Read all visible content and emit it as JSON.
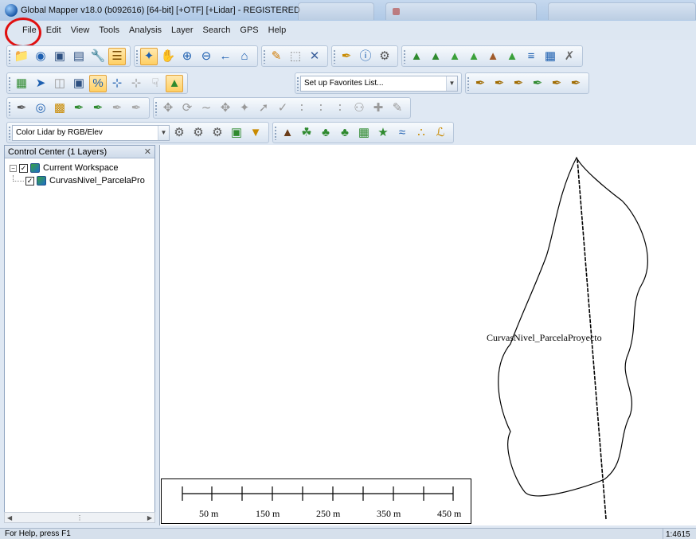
{
  "window": {
    "title": "Global Mapper v18.0 (b092616) [64-bit] [+OTF] [+Lidar] - REGISTERED"
  },
  "menu": [
    "File",
    "Edit",
    "View",
    "Tools",
    "Analysis",
    "Layer",
    "Search",
    "GPS",
    "Help"
  ],
  "toolbars": {
    "favorites_combo": "Set up Favorites List...",
    "lidar_combo": "Color Lidar by RGB/Elev"
  },
  "control_center": {
    "title": "Control Center (1 Layers)",
    "tree": [
      {
        "label": "Current Workspace",
        "checked": true,
        "expanded": true
      },
      {
        "label": "CurvasNivel_ParcelaPro",
        "checked": true
      }
    ]
  },
  "map": {
    "feature_label": "CurvasNivel_ParcelaProyecto",
    "scale_labels": [
      "50 m",
      "150 m",
      "250 m",
      "350 m",
      "450 m"
    ]
  },
  "status": {
    "help_text": "For Help, press F1",
    "scale_text": "1:4615"
  },
  "icons": {
    "row1": [
      "open-folder-icon",
      "globe-icon",
      "save-icon",
      "window-icon",
      "wrench-icon",
      "layer-stack-icon",
      "select-icon",
      "pan-icon",
      "zoom-in-icon",
      "zoom-out-icon",
      "back-arrow-icon",
      "home-icon",
      "pencil-icon",
      "rect-select-icon",
      "delete-icon",
      "measure-icon",
      "info-icon",
      "feature-info-icon",
      "terrain-1-icon",
      "terrain-2-icon",
      "terrain-3-icon",
      "terrain-4-icon",
      "terrain-5-icon",
      "terrain-6-icon",
      "terrain-7-icon",
      "terrain-8-icon",
      "terrain-9-icon"
    ],
    "colors": {
      "accent": "#ffcf63",
      "highlight": "#e01010"
    }
  }
}
